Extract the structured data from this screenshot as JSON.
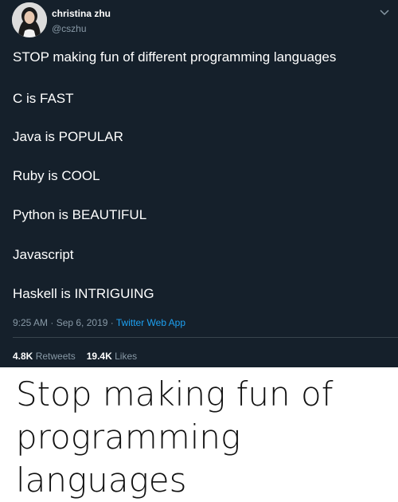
{
  "tweet": {
    "display_name": "christina zhu",
    "handle": "@cszhu",
    "lines": [
      "STOP making fun of different programming languages",
      "C is FAST",
      "Java is POPULAR",
      "Ruby is COOL",
      "Python is BEAUTIFUL",
      "Javascript",
      "Haskell is INTRIGUING"
    ],
    "time": "9:25 AM · Sep 6, 2019 · ",
    "source": "Twitter Web App",
    "retweets_count": "4.8K",
    "retweets_label": "Retweets",
    "likes_count": "19.4K",
    "likes_label": "Likes",
    "caret_icon": "chevron-down-icon",
    "colors": {
      "background": "#15202b",
      "text": "#ffffff",
      "muted": "#8899a6",
      "link": "#1da1f2"
    }
  },
  "caption": "Stop making fun of programming languages"
}
